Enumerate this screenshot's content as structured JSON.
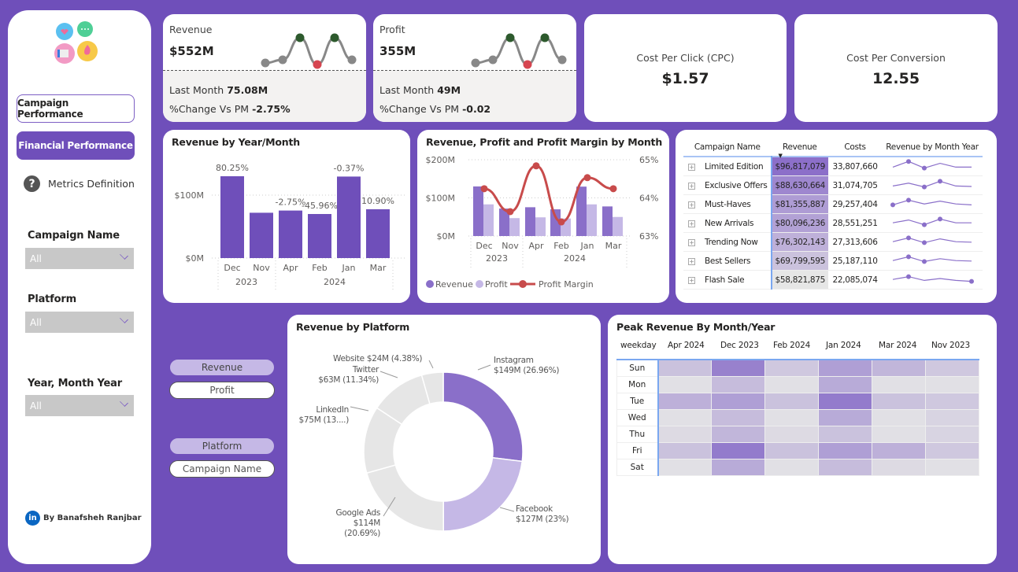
{
  "sidebar": {
    "nav": [
      "Campaign Performance",
      "Financial Performance"
    ],
    "metrics_link": "Metrics Definition",
    "filters": [
      {
        "label": "Campaign Name",
        "value": "All"
      },
      {
        "label": "Platform",
        "value": "All"
      },
      {
        "label": "Year, Month Year",
        "value": "All"
      }
    ],
    "author": "By Banafsheh Ranjbar"
  },
  "kpis": [
    {
      "label": "Revenue",
      "value": "$552M",
      "last_month_label": "Last Month",
      "last_month": "75.08M",
      "change_label": "%Change Vs PM",
      "change": "-2.75%",
      "trend": [
        0.2,
        0.3,
        1,
        0.15,
        1,
        0.3
      ],
      "point_colors": [
        "#888",
        "#888",
        "#2d5a2d",
        "#d64550",
        "#2d5a2d",
        "#888"
      ]
    },
    {
      "label": "Profit",
      "value": "355M",
      "last_month_label": "Last Month",
      "last_month": "49M",
      "change_label": "%Change Vs PM",
      "change": "-0.02",
      "trend": [
        0.2,
        0.3,
        1,
        0.15,
        1,
        0.3
      ],
      "point_colors": [
        "#888",
        "#888",
        "#2d5a2d",
        "#d64550",
        "#2d5a2d",
        "#888"
      ]
    }
  ],
  "cpc": {
    "label": "Cost Per Click (CPC)",
    "value": "$1.57"
  },
  "cpconv": {
    "label": "Cost Per Conversion",
    "value": "12.55"
  },
  "chart_data": [
    {
      "type": "bar",
      "title": "Revenue by Year/Month",
      "categories": [
        "Dec",
        "Nov",
        "Apr",
        "Feb",
        "Jan",
        "Mar"
      ],
      "groups": [
        {
          "label": "2023",
          "span": 2
        },
        {
          "label": "2024",
          "span": 4
        }
      ],
      "values": [
        130,
        72,
        75.5,
        70,
        129.5,
        77.6
      ],
      "data_labels": [
        "80.25%",
        "",
        "-2.75%",
        "-45.96%",
        "-0.37%",
        "10.90%"
      ],
      "label_colors": [
        "#444",
        "",
        "#e03c3c",
        "#e03c3c",
        "#e03c3c",
        "#444"
      ],
      "yticks": [
        "$0M",
        "$100M"
      ],
      "ylim": [
        0,
        130
      ],
      "unit": "$M",
      "color": "#6f4fba"
    },
    {
      "type": "bar+line",
      "title": "Revenue, Profit and Profit Margin by Month",
      "categories": [
        "Dec",
        "Nov",
        "Apr",
        "Feb",
        "Jan",
        "Mar"
      ],
      "groups": [
        {
          "label": "2023",
          "span": 2
        },
        {
          "label": "2024",
          "span": 4
        }
      ],
      "series": [
        {
          "name": "Revenue",
          "values": [
            130,
            72,
            75.5,
            70,
            129.5,
            77.6
          ],
          "color": "#8a6fc9"
        },
        {
          "name": "Profit",
          "values": [
            83,
            47,
            49,
            46,
            83,
            50
          ],
          "color": "#c5b8e6"
        },
        {
          "name": "Profit Margin",
          "values": [
            64.24,
            63.64,
            64.84,
            63.37,
            64.53,
            64.24
          ],
          "color": "#c84b4b",
          "axis": "right"
        }
      ],
      "yticks": [
        "$0M",
        "$100M",
        "$200M"
      ],
      "ylim": [
        0,
        200
      ],
      "y2ticks": [
        "63%",
        "64%",
        "65%"
      ],
      "y2lim": [
        63,
        65
      ],
      "legend": "bottom-left"
    },
    {
      "type": "donut",
      "title": "Revenue by Platform",
      "slices": [
        {
          "name": "Instagram",
          "label": "$149M (26.96%)",
          "pct": 26.96,
          "color": "#8a6fc9"
        },
        {
          "name": "Facebook",
          "label": "$127M (23%)",
          "pct": 23,
          "color": "#c5b8e6"
        },
        {
          "name": "Google Ads",
          "label": "$114M (20.69%)",
          "pct": 20.69,
          "color": "#e6e6e6"
        },
        {
          "name": "LinkedIn",
          "label": "$75M (13....)",
          "pct": 13.63,
          "color": "#e6e6e6"
        },
        {
          "name": "Twitter",
          "label": "$63M (11.34%)",
          "pct": 11.34,
          "color": "#e6e6e6"
        },
        {
          "name": "Website",
          "label": "$24M (4.38%)",
          "pct": 4.38,
          "color": "#e6e6e6"
        }
      ]
    },
    {
      "type": "heatmap",
      "title": "Peak Revenue By Month/Year",
      "corner": "weekday",
      "columns": [
        "Apr 2024",
        "Dec 2023",
        "Feb 2024",
        "Jan 2024",
        "Mar 2024",
        "Nov 2023"
      ],
      "rows": [
        "Sun",
        "Mon",
        "Tue",
        "Wed",
        "Thu",
        "Fri",
        "Sat"
      ],
      "intensity": [
        [
          0.3,
          0.85,
          0.25,
          0.6,
          0.4,
          0.25
        ],
        [
          0.05,
          0.35,
          0.05,
          0.5,
          0.05,
          0.05
        ],
        [
          0.45,
          0.6,
          0.3,
          0.9,
          0.3,
          0.25
        ],
        [
          0.05,
          0.35,
          0.05,
          0.5,
          0.05,
          0.15
        ],
        [
          0.1,
          0.4,
          0.1,
          0.3,
          0.05,
          0.15
        ],
        [
          0.3,
          0.9,
          0.3,
          0.6,
          0.45,
          0.25
        ],
        [
          0.05,
          0.5,
          0.05,
          0.35,
          0.1,
          0.05
        ]
      ],
      "color_low": "#e6e6e6",
      "color_high": "#8a6fc9"
    }
  ],
  "table": {
    "headers": [
      "Campaign Name",
      "Revenue",
      "Costs",
      "Revenue by Month Year"
    ],
    "rows": [
      {
        "name": "Limited Edition",
        "revenue": "$96,817,079",
        "costs": "33,807,660",
        "level": 1,
        "spark": [
          0.3,
          0.9,
          0.2,
          0.7,
          0.3,
          0.3
        ]
      },
      {
        "name": "Exclusive Offers",
        "revenue": "$88,630,664",
        "costs": "31,074,705",
        "level": 0.8,
        "spark": [
          0.3,
          0.6,
          0.2,
          0.8,
          0.3,
          0.25
        ]
      },
      {
        "name": "Must-Haves",
        "revenue": "$81,355,887",
        "costs": "29,257,404",
        "level": 0.62,
        "spark": [
          0.3,
          0.8,
          0.4,
          0.7,
          0.4,
          0.3
        ]
      },
      {
        "name": "New Arrivals",
        "revenue": "$80,096,236",
        "costs": "28,551,251",
        "level": 0.58,
        "spark": [
          0.4,
          0.7,
          0.2,
          0.8,
          0.4,
          0.4
        ]
      },
      {
        "name": "Trending Now",
        "revenue": "$76,302,143",
        "costs": "27,313,606",
        "level": 0.45,
        "spark": [
          0.4,
          0.8,
          0.3,
          0.7,
          0.4,
          0.35
        ]
      },
      {
        "name": "Best Sellers",
        "revenue": "$69,799,595",
        "costs": "25,187,110",
        "level": 0.3,
        "spark": [
          0.4,
          0.8,
          0.3,
          0.6,
          0.4,
          0.35
        ]
      },
      {
        "name": "Flash Sale",
        "revenue": "$58,821,875",
        "costs": "22,085,074",
        "level": 0,
        "spark": [
          0.4,
          0.7,
          0.3,
          0.5,
          0.3,
          0.2
        ]
      }
    ]
  },
  "toggles": {
    "measure": [
      "Revenue",
      "Profit"
    ],
    "dimension": [
      "Platform",
      "Campaign Name"
    ]
  }
}
